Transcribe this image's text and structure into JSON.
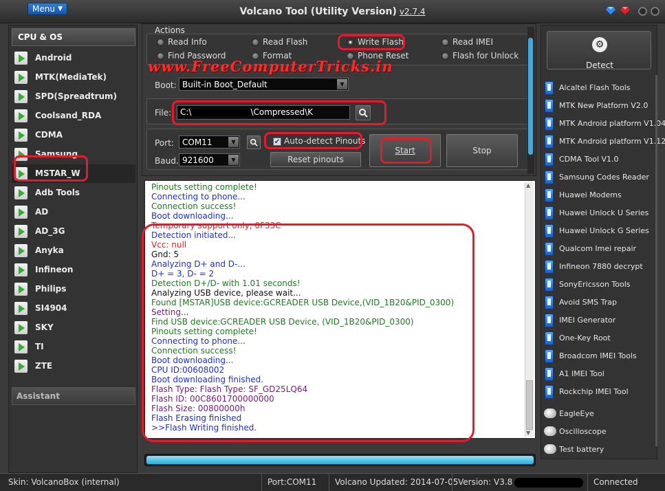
{
  "titlebar": {
    "menu_label": "Menu",
    "title": "Volcano Tool (Utility Version)",
    "version": "v2.7.4"
  },
  "left_panel": {
    "header": "CPU & OS",
    "items": [
      {
        "label": "Android"
      },
      {
        "label": "MTK(MediaTek)"
      },
      {
        "label": "SPD(Spreadtrum)"
      },
      {
        "label": "Coolsand_RDA"
      },
      {
        "label": "CDMA"
      },
      {
        "label": "Samsung"
      },
      {
        "label": "MSTAR_W",
        "active": true
      },
      {
        "label": "Adb Tools"
      },
      {
        "label": "AD"
      },
      {
        "label": "AD_3G"
      },
      {
        "label": "Anyka"
      },
      {
        "label": "Infineon"
      },
      {
        "label": "Philips"
      },
      {
        "label": "SI4904"
      },
      {
        "label": "SKY"
      },
      {
        "label": "TI"
      },
      {
        "label": "ZTE"
      }
    ],
    "assistant_label": "Assistant"
  },
  "actions": {
    "legend": "Actions",
    "options": [
      {
        "label": "Read Info",
        "selected": false
      },
      {
        "label": "Read Flash",
        "selected": false
      },
      {
        "label": "Write Flash",
        "selected": true
      },
      {
        "label": "Read IMEI",
        "selected": false
      },
      {
        "label": "Find Password",
        "selected": false
      },
      {
        "label": "Format",
        "selected": false
      },
      {
        "label": "Phone Reset",
        "selected": false
      },
      {
        "label": "Flash for Unlock",
        "selected": false
      }
    ]
  },
  "watermark": "www.FreeComputerTricks.in",
  "boot": {
    "label": "Boot:",
    "value": "Built-in Boot_Default"
  },
  "file": {
    "label": "File:",
    "value_prefix": "C:\\",
    "value_suffix": "\\Compressed\\K"
  },
  "port": {
    "label": "Port:",
    "value": "COM11"
  },
  "baud": {
    "label": "Baud.",
    "value": "921600"
  },
  "auto_detect": {
    "label": "Auto-detect Pinouts",
    "checked": true
  },
  "buttons": {
    "reset_pinouts": "Reset pinouts",
    "start": "Start",
    "stop": "Stop"
  },
  "log": [
    {
      "text": "Pinouts setting complete!",
      "color": "green"
    },
    {
      "text": "Connecting to phone...",
      "color": "blue"
    },
    {
      "text": "Connection success!",
      "color": "green"
    },
    {
      "text": "Boot downloading...",
      "color": "blue"
    },
    {
      "text": "Temporary support only, 0F33C",
      "color": "red"
    },
    {
      "text": "Detection initiated...",
      "color": "blue"
    },
    {
      "text": "Vcc: null",
      "color": "red"
    },
    {
      "text": "Gnd: 5",
      "color": "black"
    },
    {
      "text": "Analyzing D+ and D-...",
      "color": "blue"
    },
    {
      "text": "D+ = 3, D- = 2",
      "color": "blue"
    },
    {
      "text": "Detection D+/D- with 1.01 seconds!",
      "color": "green"
    },
    {
      "text": "Analyzing USB device, please wait...",
      "color": "black"
    },
    {
      "text": "Found [MSTAR]USB device:GCREADER USB Device,(VID_1B20&PID_0300)",
      "color": "green"
    },
    {
      "text": "Setting...",
      "color": "purple"
    },
    {
      "text": "Find USB device:GCREADER USB Device, (VID_1B20&PID_0300)",
      "color": "green"
    },
    {
      "text": "Pinouts setting complete!",
      "color": "green"
    },
    {
      "text": "Connecting to phone...",
      "color": "blue"
    },
    {
      "text": "Connection success!",
      "color": "green"
    },
    {
      "text": "Boot downloading...",
      "color": "blue"
    },
    {
      "text": "CPU ID:00608002",
      "color": "blue"
    },
    {
      "text": "Boot downloading finished.",
      "color": "blue"
    },
    {
      "text": "Flash Type: Flash Type: SF_GD25LQ64",
      "color": "purple"
    },
    {
      "text": "Flash ID:   00C8601700000000",
      "color": "purple"
    },
    {
      "text": "Flash Size: 00800000h",
      "color": "purple"
    },
    {
      "text": "Flash Erasing finished",
      "color": "blue"
    },
    {
      "text": ">>Flash Writing finished.",
      "color": "blue"
    }
  ],
  "progress": 1.0,
  "right_panel": {
    "detect_label": "Detect",
    "tools": [
      "Alcaltel Flash Tools",
      "MTK New Platform V2.0",
      "MTK Android platform V1.04",
      "MTK Android platform V1.12",
      "CDMA Tool  V1.0",
      "Samsung Codes Reader",
      "Huawei Modems",
      "Huawei Unlock U Series",
      "Huawei Unlock G Series",
      "Qualcom Imei repair",
      "Infineon 7880 decrypt",
      "SonyEricsson Tools",
      "Avoid SMS Trap",
      "IMEI Generator",
      "One-Key Root",
      "Broadcom IMEI Tools",
      "A1 IMEI Tool",
      "Rockchip IMEI Tool"
    ],
    "utilities": [
      "EagleEye",
      "Oscilloscope",
      "Test battery"
    ]
  },
  "statusbar": {
    "skin": "Skin: VolcanoBox (internal)",
    "port": "Port:COM11",
    "updated": "Volcano Updated: 2014-07-05",
    "version": "Version: V3.8",
    "connection": "Connected"
  },
  "colors": {
    "accent_red": "#e21c2d",
    "progress": "#2aaed8"
  }
}
